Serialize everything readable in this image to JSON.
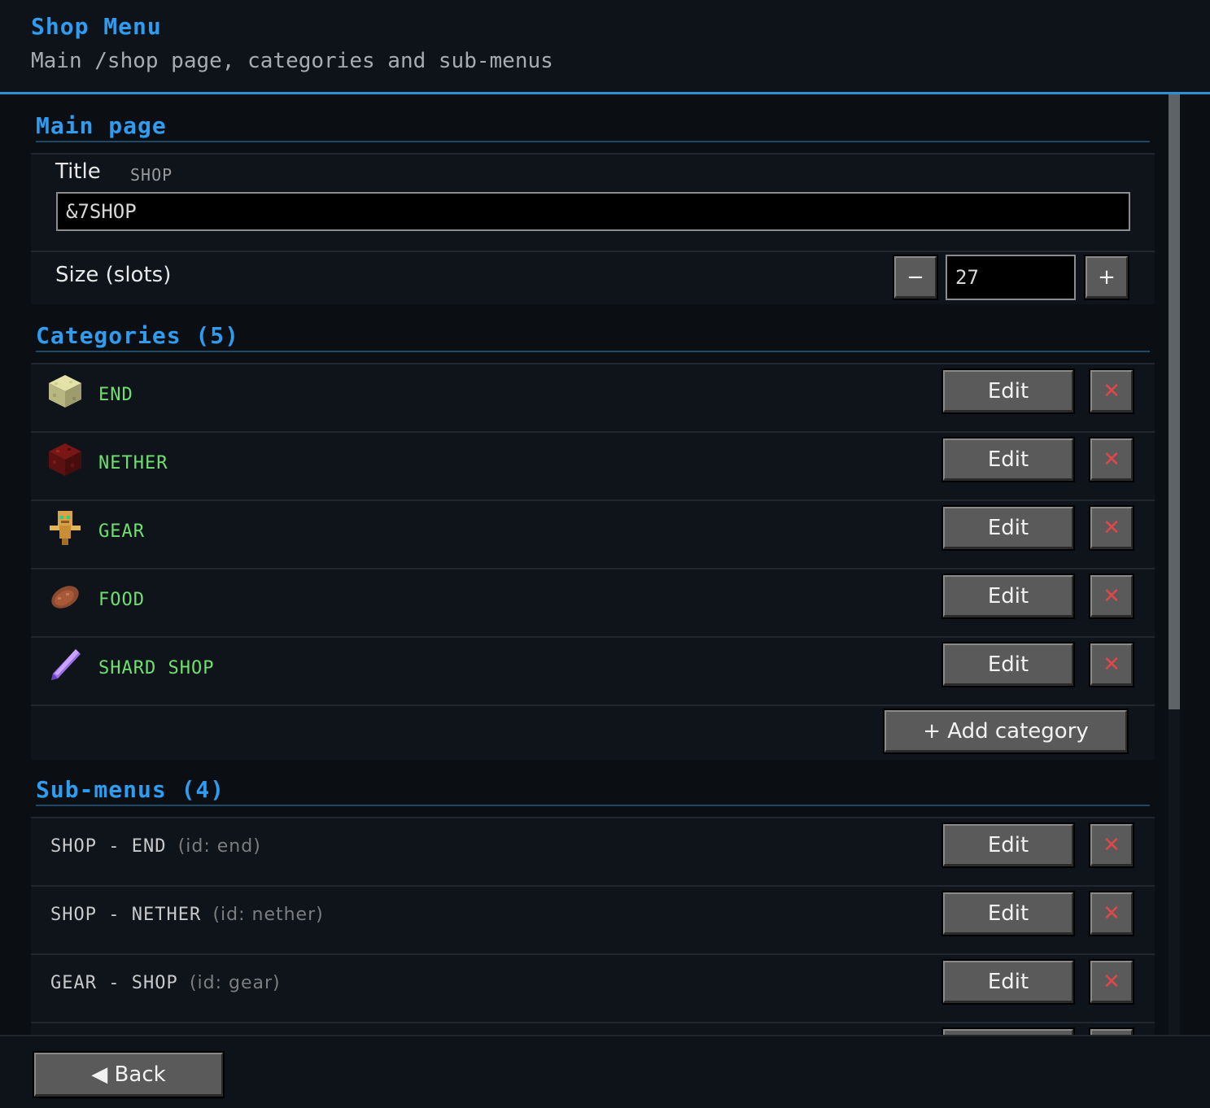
{
  "header": {
    "title": "Shop Menu",
    "subtitle": "Main /shop page, categories and sub-menus"
  },
  "main_page": {
    "heading": "Main page",
    "title_label": "Title",
    "title_preview": "SHOP",
    "title_value": "&7SHOP",
    "size_label": "Size (slots)",
    "size_value": "27",
    "minus_label": "−",
    "plus_label": "+"
  },
  "categories": {
    "heading": "Categories (5)",
    "items": [
      {
        "name": "END",
        "icon": "end-stone-icon"
      },
      {
        "name": "NETHER",
        "icon": "nether-wart-block-icon"
      },
      {
        "name": "GEAR",
        "icon": "totem-icon"
      },
      {
        "name": "FOOD",
        "icon": "steak-icon"
      },
      {
        "name": "SHARD SHOP",
        "icon": "amethyst-shard-icon"
      }
    ],
    "edit_label": "Edit",
    "delete_label": "✕",
    "add_label": "+ Add category"
  },
  "submenus": {
    "heading": "Sub-menus (4)",
    "items": [
      {
        "name": "SHOP - END",
        "id": "(id: end)"
      },
      {
        "name": "SHOP - NETHER",
        "id": "(id: nether)"
      },
      {
        "name": "GEAR - SHOP",
        "id": "(id: gear)"
      }
    ],
    "edit_label": "Edit",
    "delete_label": "✕"
  },
  "footer": {
    "back_label": "◀ Back"
  },
  "colors": {
    "accent": "#2f9cf0",
    "category_text": "#6fe06f",
    "delete": "#e04848"
  }
}
